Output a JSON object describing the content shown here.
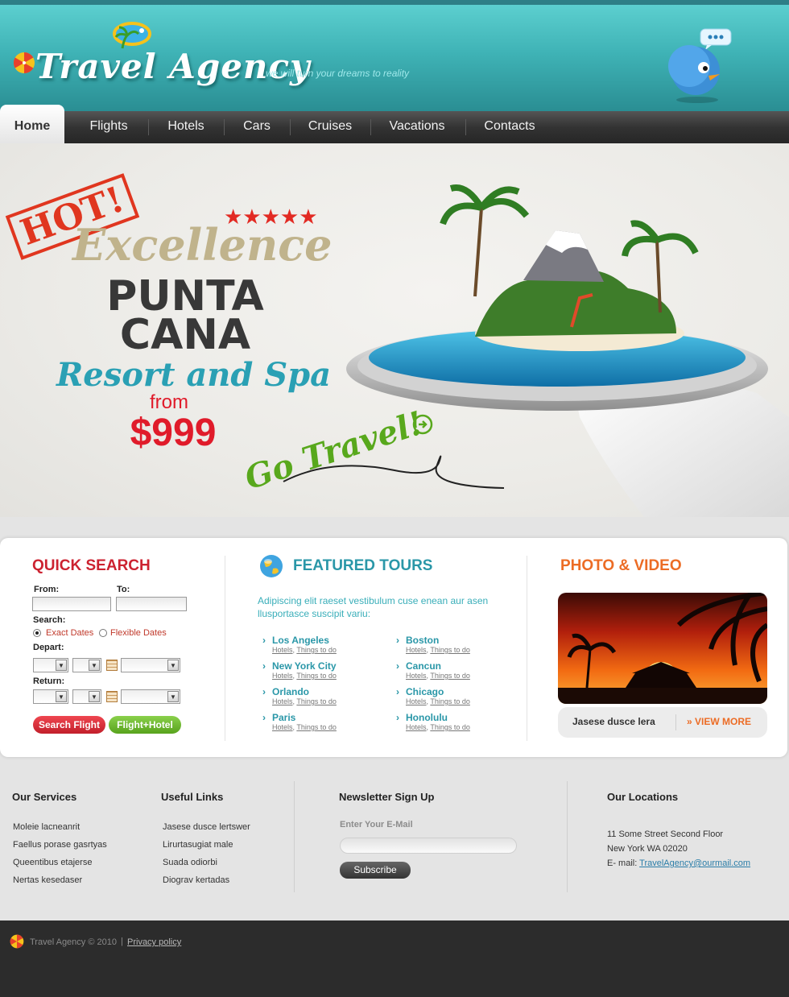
{
  "brand": {
    "name": "Travel Agency",
    "tagline": "we will turn your dreams to reality"
  },
  "nav": {
    "items": [
      {
        "label": "Home",
        "active": true
      },
      {
        "label": "Flights"
      },
      {
        "label": "Hotels"
      },
      {
        "label": "Cars"
      },
      {
        "label": "Cruises"
      },
      {
        "label": "Vacations"
      },
      {
        "label": "Contacts"
      }
    ]
  },
  "hero": {
    "stamp": "HOT!",
    "rating_stars": 5,
    "excellence": "Excellence",
    "line1": "PUNTA",
    "line2": "CANA",
    "resort": "Resort and Spa",
    "from": "from",
    "price": "$999",
    "cta": "Go Travel!"
  },
  "quick_search": {
    "title": "QUICK SEARCH",
    "from_label": "From:",
    "to_label": "To:",
    "search_label": "Search:",
    "exact_dates": "Exact Dates",
    "flexible_dates": "Flexible Dates",
    "depart_label": "Depart:",
    "return_label": "Return:",
    "search_flight_btn": "Search Flight",
    "flight_hotel_btn": "Flight+Hotel"
  },
  "featured": {
    "title": "FEATURED TOURS",
    "description": "Adipiscing elit raeset vestibulum cuse enean aur asen llusportasce suscipit variu:",
    "hotels_label": "Hotels",
    "things_label": "Things to do",
    "tours": [
      "Los Angeles",
      "New York City",
      "Orlando",
      "Paris",
      "Boston",
      "Cancun",
      "Chicago",
      "Honolulu"
    ]
  },
  "photo_video": {
    "title": "PHOTO & VIDEO",
    "caption": "Jasese dusce lera",
    "more": "» VIEW MORE"
  },
  "footer": {
    "services_title": "Our Services",
    "services": [
      "Moleie lacneanrit",
      "Faellus porase gasrtyas",
      "Queentibus etajerse",
      "Nertas kesedaser"
    ],
    "links_title": "Useful Links",
    "links": [
      "Jasese dusce lertswer",
      "Lirurtasugiat male",
      "Suada odiorbi",
      "Diograv kertadas"
    ],
    "newsletter_title": "Newsletter Sign Up",
    "newsletter_label": "Enter Your E-Mail",
    "subscribe": "Subscribe",
    "locations_title": "Our Locations",
    "address1": "11 Some Street Second Floor",
    "address2": "New York WA 02020",
    "email_label": "E- mail:",
    "email": "TravelAgency@ourmail.com"
  },
  "bottom": {
    "copyright": "Travel Agency © 2010",
    "privacy": "Privacy policy"
  },
  "colors": {
    "header_teal": "#3fb3b6",
    "nav_dark": "#333333",
    "accent_red": "#cc2230",
    "accent_teal": "#2a97a8",
    "accent_orange": "#ec6c25",
    "accent_green": "#58a31d"
  }
}
